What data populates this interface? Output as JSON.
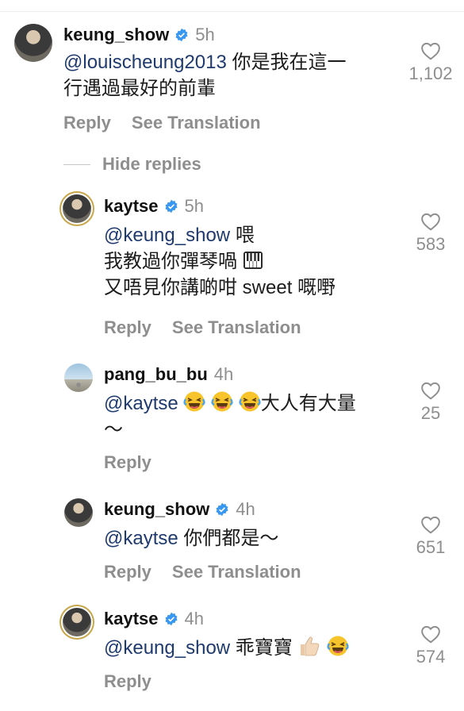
{
  "comments": [
    {
      "username": "keung_show",
      "time": "5h",
      "mention": "@louischeung2013",
      "text": " 你是我在這一",
      "text2": "行遇過最好的前輩",
      "likes": "1,102",
      "reply": "Reply",
      "translate": "See Translation"
    },
    {
      "username": "kaytse",
      "time": "5h",
      "mention": "@keung_show",
      "text": " 喂",
      "text2": "我教過你彈琴喎",
      "text3": "又唔見你講啲咁 sweet 嘅嘢",
      "likes": "583",
      "reply": "Reply",
      "translate": "See Translation"
    },
    {
      "username": "pang_bu_bu",
      "time": "4h",
      "mention": "@kaytse",
      "text": "大人有大量",
      "text2": "～",
      "likes": "25",
      "reply": "Reply"
    },
    {
      "username": "keung_show",
      "time": "4h",
      "mention": "@kaytse",
      "text": " 你們都是～",
      "likes": "651",
      "reply": "Reply",
      "translate": "See Translation"
    },
    {
      "username": "kaytse",
      "time": "4h",
      "mention": "@keung_show",
      "text": " 乖寶寶",
      "likes": "574",
      "reply": "Reply"
    }
  ],
  "hide_replies": "Hide replies",
  "colors": {
    "verified": "#3897f0",
    "mention": "#1e3a6e",
    "muted": "#8e8e8e"
  },
  "icons": [
    "heart-outline-icon",
    "verified-badge-icon",
    "piano-emoji",
    "laughing-emoji",
    "thumbs-up-emoji"
  ]
}
